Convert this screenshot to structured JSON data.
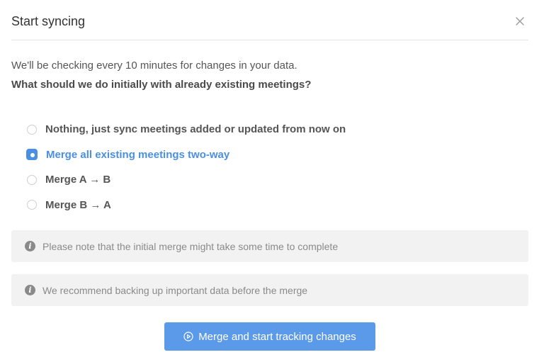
{
  "dialog": {
    "title": "Start syncing",
    "close_icon": "close-icon",
    "description": "We'll be checking every 10 minutes for changes in your data.",
    "question": "What should we do initially with already existing meetings?"
  },
  "options": [
    {
      "label": "Nothing, just sync meetings added or updated from now on",
      "selected": false
    },
    {
      "label": "Merge all existing meetings two-way",
      "selected": true
    },
    {
      "label": "Merge A → B",
      "selected": false
    },
    {
      "label": "Merge B → A",
      "selected": false
    }
  ],
  "notices": [
    {
      "icon": "info-icon",
      "text": "Please note that the initial merge might take some time to complete"
    },
    {
      "icon": "info-icon",
      "text": "We recommend backing up important data before the merge"
    }
  ],
  "primary_button": {
    "icon": "play-circle-icon",
    "label": "Merge and start tracking changes"
  },
  "colors": {
    "accent": "#4a90e2",
    "button": "#5a9ae8",
    "notice_bg": "#f2f2f2",
    "muted_text": "#8a8a8a"
  }
}
